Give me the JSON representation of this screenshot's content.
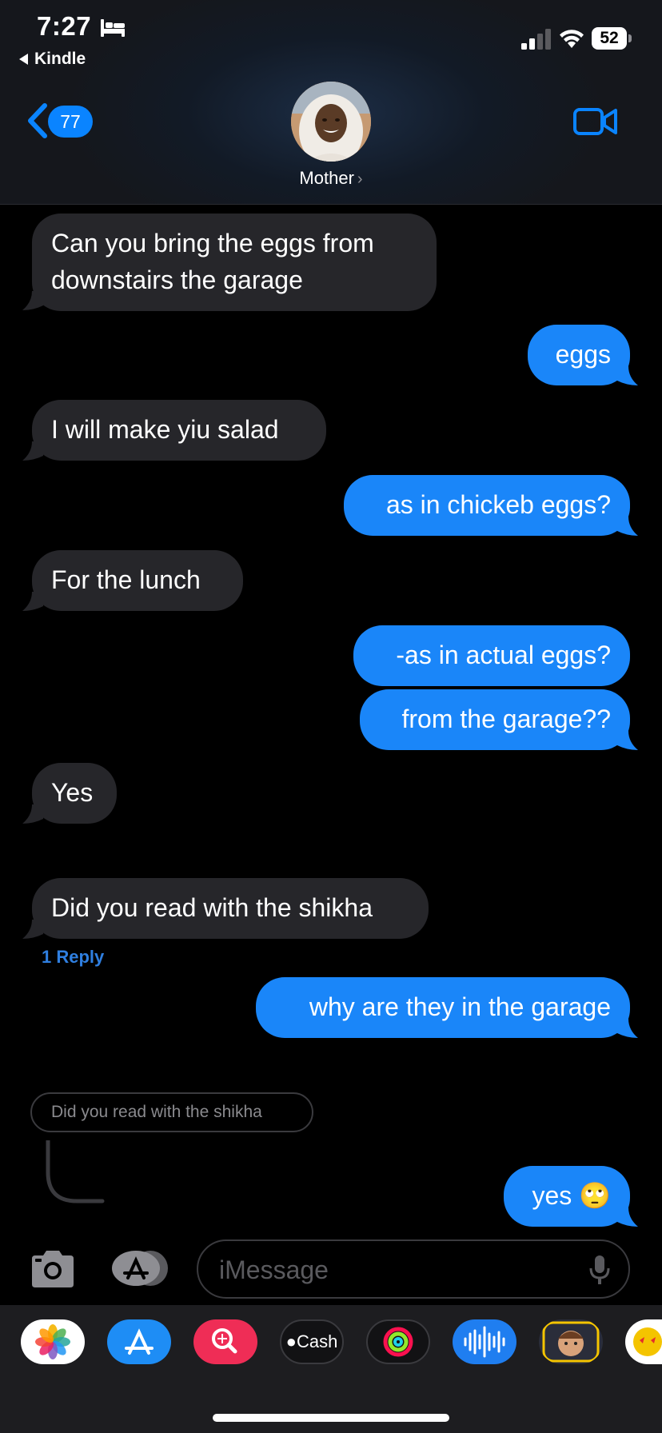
{
  "status_bar": {
    "time": "7:27",
    "back_app": "Kindle",
    "battery": "52"
  },
  "header": {
    "unread_count": "77",
    "contact_name": "Mother",
    "contact_chevron": "›"
  },
  "messages": [
    {
      "direction": "incoming",
      "lines": [
        "Can you bring the eggs from",
        "downstairs the garage"
      ]
    },
    {
      "direction": "outgoing",
      "text": "eggs"
    },
    {
      "direction": "incoming",
      "text": "I will make yiu salad"
    },
    {
      "direction": "outgoing",
      "text": "as in chickeb eggs?"
    },
    {
      "direction": "incoming",
      "text": "For the lunch"
    },
    {
      "direction": "outgoing",
      "text": "-as in actual eggs?"
    },
    {
      "direction": "outgoing",
      "text": "from the garage??"
    },
    {
      "direction": "incoming",
      "text": "Yes"
    },
    {
      "direction": "incoming",
      "text": "Did you read with the shikha",
      "reply_count": "1 Reply"
    },
    {
      "direction": "outgoing",
      "text": "why are they in the garage"
    },
    {
      "direction": "incoming_quoted",
      "text": "Did you read with the shikha"
    },
    {
      "direction": "outgoing",
      "text": "yes 🙄"
    }
  ],
  "composer": {
    "placeholder": "iMessage"
  },
  "drawer": {
    "apps": [
      "photos-app",
      "app-store-app",
      "search-images-app",
      "apple-cash-app",
      "activity-app",
      "audio-message-app",
      "memoji-app",
      "stickers-app"
    ],
    "cash_label": "Cash"
  },
  "colors": {
    "accent": "#0a84ff",
    "outgoing_bubble": "#1a86f9",
    "incoming_bubble": "#26262a",
    "background": "#000000"
  }
}
